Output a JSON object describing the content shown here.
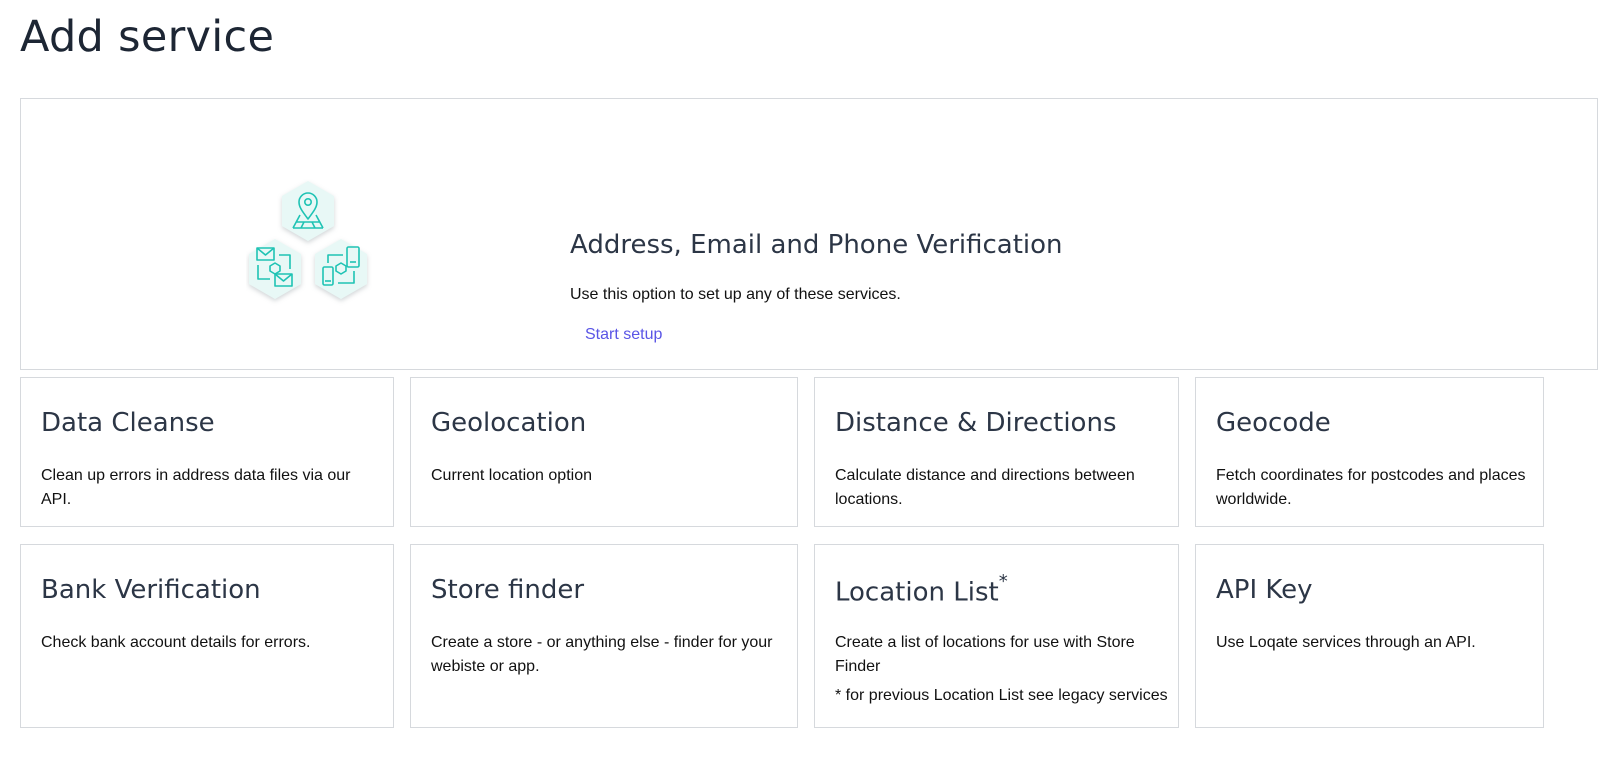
{
  "page": {
    "title": "Add service"
  },
  "hero": {
    "title": "Address, Email and Phone Verification",
    "description": "Use this option to set up any of these services.",
    "link_label": "Start setup",
    "icons": [
      "map-pin-icon",
      "email-icon",
      "phone-icon"
    ],
    "accent_color": "#1fc3b4"
  },
  "services": [
    {
      "title": "Data Cleanse",
      "description": "Clean up errors in address data files via our API."
    },
    {
      "title": "Geolocation",
      "description": "Current location option"
    },
    {
      "title": "Distance & Directions",
      "description": "Calculate distance and directions between locations."
    },
    {
      "title": "Geocode",
      "description": "Fetch coordinates for postcodes and places worldwide."
    },
    {
      "title": "Bank Verification",
      "description": "Check bank account details for errors."
    },
    {
      "title": "Store finder",
      "description": "Create a store - or anything else - finder for your webiste or app."
    },
    {
      "title": "Location List",
      "title_mark": "*",
      "description": "Create a list of locations for use with Store Finder",
      "note": "* for previous Location List see legacy services"
    },
    {
      "title": "API Key",
      "description": "Use Loqate services through an API."
    }
  ],
  "colors": {
    "link": "#5a55e6",
    "border": "#d6d9dd",
    "heading": "#2c3646"
  }
}
